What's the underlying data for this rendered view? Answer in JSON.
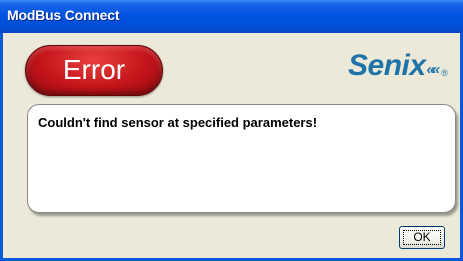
{
  "window": {
    "title": "ModBus Connect"
  },
  "header": {
    "error_label": "Error",
    "brand": {
      "name": "Senix",
      "mark": "««",
      "registered": "®"
    }
  },
  "message": {
    "text": "Couldn't find sensor at specified parameters!"
  },
  "footer": {
    "ok_label": "OK"
  },
  "colors": {
    "titlebar": "#0054e3",
    "window_bg": "#ece9d8",
    "error_red": "#c4141a",
    "brand_blue": "#1f73a8"
  }
}
